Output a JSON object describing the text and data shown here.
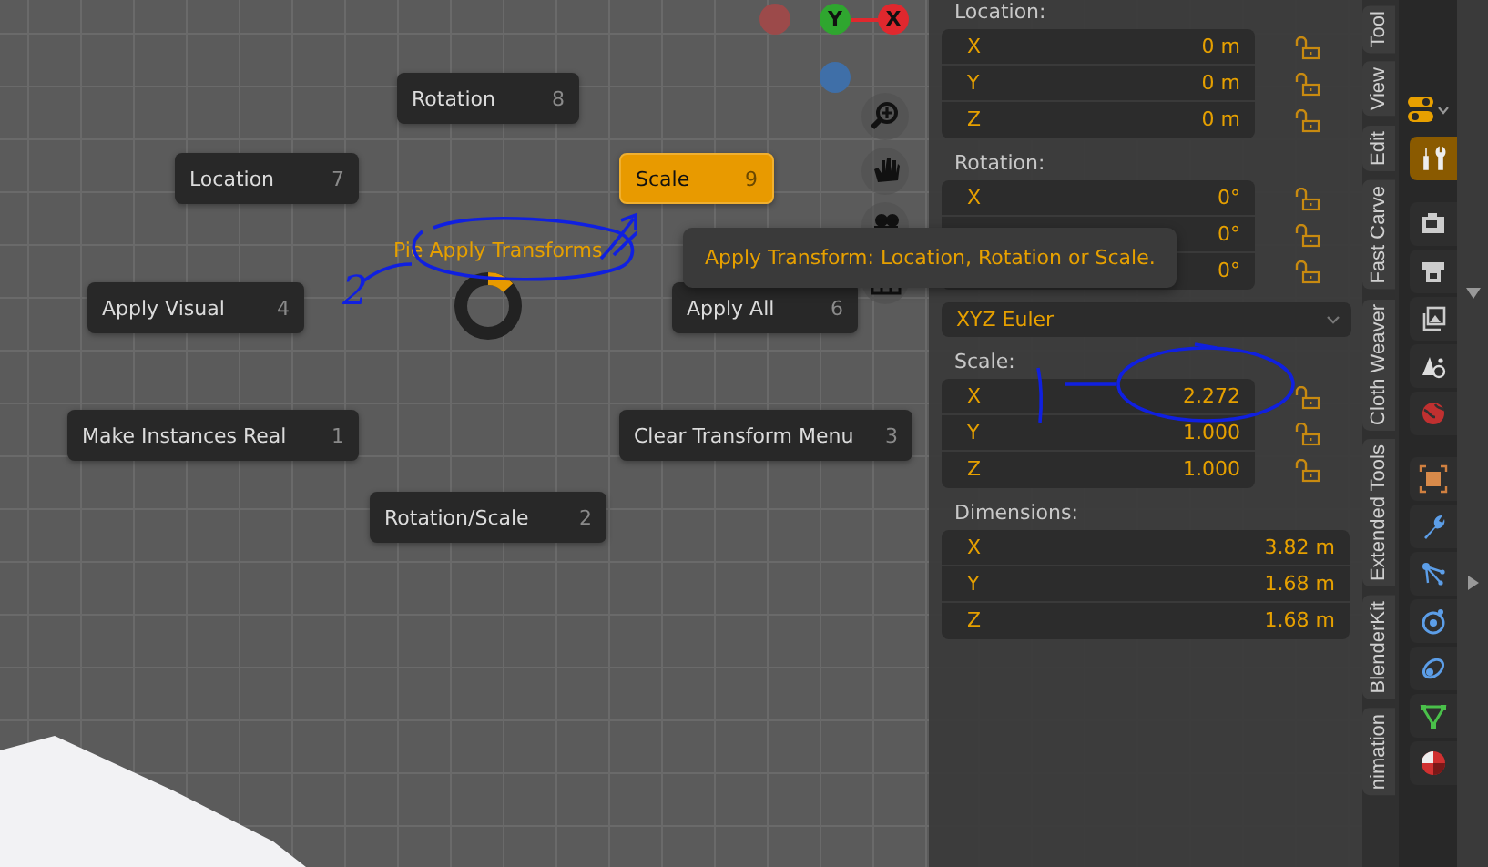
{
  "gizmo": [
    {
      "kind": "dot",
      "color": "#9c4a4a"
    },
    {
      "kind": "axis",
      "label": "Y",
      "color": "#2fa62f"
    },
    {
      "kind": "axis",
      "label": "X",
      "color": "#e0282e"
    },
    {
      "kind": "dot",
      "color": "#3f6fa8"
    }
  ],
  "pie": {
    "title": "Pie Apply Transforms",
    "items": [
      {
        "label": "Rotation",
        "key": "8",
        "selected": false
      },
      {
        "label": "Location",
        "key": "7",
        "selected": false
      },
      {
        "label": "Scale",
        "key": "9",
        "selected": true
      },
      {
        "label": "Apply Visual",
        "key": "4",
        "selected": false
      },
      {
        "label": "Apply All",
        "key": "6",
        "selected": false
      },
      {
        "label": "Make Instances Real",
        "key": "1",
        "selected": false
      },
      {
        "label": "Clear Transform Menu",
        "key": "3",
        "selected": false
      },
      {
        "label": "Rotation/Scale",
        "key": "2",
        "selected": false
      }
    ]
  },
  "tooltip": "Apply Transform: Location, Rotation or Scale.",
  "annotations": [
    {
      "text": "2"
    }
  ],
  "panel": {
    "sections": [
      {
        "kind": "vector",
        "label": "Location:",
        "rows": [
          {
            "axis": "X",
            "value": "0 m",
            "locked": false
          },
          {
            "axis": "Y",
            "value": "0 m",
            "locked": false
          },
          {
            "axis": "Z",
            "value": "0 m",
            "locked": false
          }
        ]
      },
      {
        "kind": "vector",
        "label": "Rotation:",
        "rows": [
          {
            "axis": "X",
            "value": "0°",
            "locked": false
          },
          {
            "value": "0°",
            "locked": false
          },
          {
            "value": "0°",
            "locked": false
          }
        ]
      },
      {
        "kind": "dropdown",
        "value": "XYZ Euler"
      },
      {
        "kind": "vector",
        "label": "Scale:",
        "rows": [
          {
            "axis": "X",
            "value": "2.272",
            "locked": false
          },
          {
            "axis": "Y",
            "value": "1.000",
            "locked": false
          },
          {
            "axis": "Z",
            "value": "1.000",
            "locked": false
          }
        ]
      },
      {
        "kind": "dims",
        "label": "Dimensions:",
        "rows": [
          {
            "axis": "X",
            "value": "3.82 m"
          },
          {
            "axis": "Y",
            "value": "1.68 m"
          },
          {
            "axis": "Z",
            "value": "1.68 m"
          }
        ]
      }
    ]
  },
  "side_tabs": [
    {
      "label": "Tool"
    },
    {
      "label": "View"
    },
    {
      "label": "Edit"
    },
    {
      "label": "Fast Carve"
    },
    {
      "label": "Cloth Weaver"
    },
    {
      "label": "Extended Tools"
    },
    {
      "label": "BlenderKit"
    },
    {
      "label": "nimation"
    }
  ],
  "property_tabs": [
    {
      "kind": "tool",
      "selected": true
    },
    {
      "kind": "render",
      "selected": false
    },
    {
      "kind": "output",
      "selected": false
    },
    {
      "kind": "view-layer",
      "selected": false
    },
    {
      "kind": "scene",
      "selected": false
    },
    {
      "kind": "world",
      "selected": false
    },
    {
      "kind": "object",
      "selected": false
    },
    {
      "kind": "modifier",
      "selected": false
    },
    {
      "kind": "particles",
      "selected": false
    },
    {
      "kind": "physics",
      "selected": false
    },
    {
      "kind": "constraints",
      "selected": false
    },
    {
      "kind": "data",
      "selected": false
    },
    {
      "kind": "material",
      "selected": false
    }
  ]
}
